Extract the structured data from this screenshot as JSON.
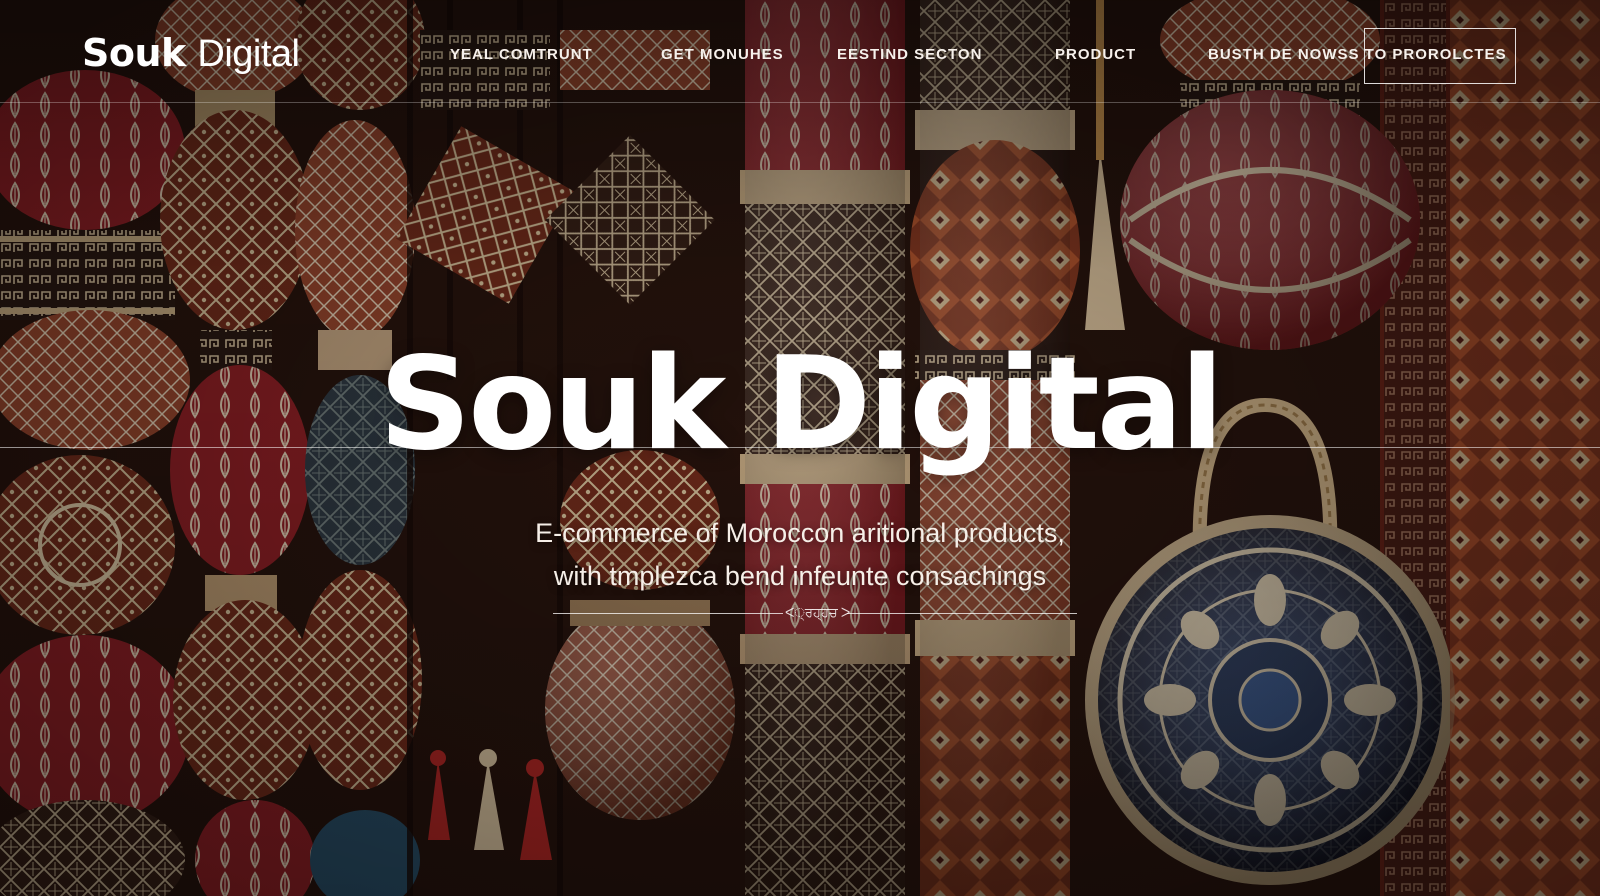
{
  "brand": {
    "name_bold": "Souk",
    "name_light": "Digital"
  },
  "nav": {
    "items": [
      {
        "label": "YEAL COMTRUNT"
      },
      {
        "label": "GET MONUHES"
      },
      {
        "label": "EESTIND SECTON"
      },
      {
        "label": "PRODUCT"
      },
      {
        "label": "BUSTH DE NOWSS TO PROROLCTES"
      }
    ]
  },
  "hero": {
    "title": "Souk Digital",
    "subtitle_line_1": "E-commerce of Moroccon aritional products,",
    "subtitle_line_2": "with tmplezca bend infeunte consachings",
    "divider_ornament": "ᐸ੍ਰਹ੍ਹਚ ᐳ"
  },
  "colors": {
    "text": "#ffffff",
    "background_dark": "#2a1510",
    "terracotta": "#a4482d",
    "crimson": "#8e1f24",
    "cream": "#e8d3b2",
    "indigo": "#1f2c4f"
  }
}
